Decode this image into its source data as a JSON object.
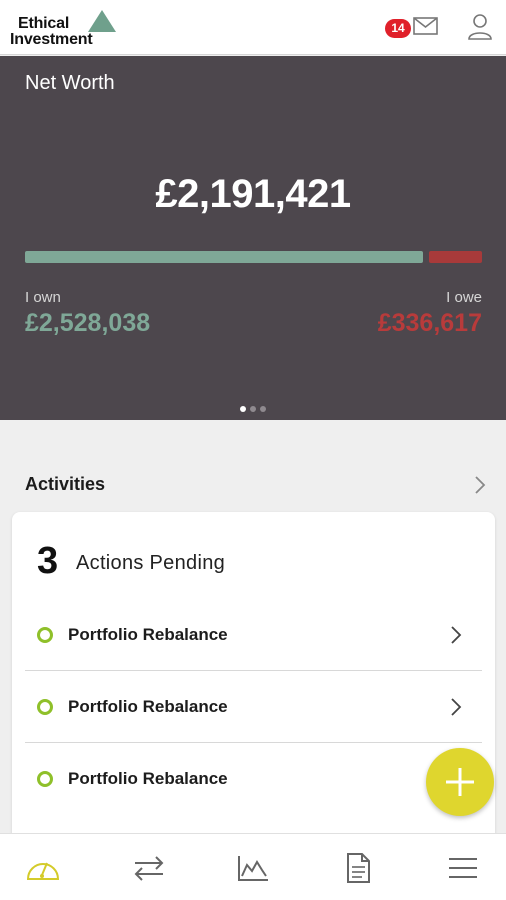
{
  "header": {
    "logo_line1": "Ethical",
    "logo_line2": "Investment",
    "notification_count": "14",
    "icons": [
      "mail-icon",
      "user-icon"
    ]
  },
  "networth": {
    "title": "Net Worth",
    "amount": "£2,191,421",
    "own_label": "I own",
    "own_value": "£2,528,038",
    "owe_label": "I owe",
    "owe_value": "£336,617",
    "own_fraction": 0.882,
    "carousel_pages": 3,
    "carousel_active": 0,
    "colors": {
      "background": "#4d474d",
      "own": "#7fa897",
      "owe": "#b83b3b"
    }
  },
  "activities": {
    "title": "Activities",
    "pending_count": "3",
    "pending_label": "Actions Pending",
    "items": [
      {
        "label": "Portfolio Rebalance"
      },
      {
        "label": "Portfolio Rebalance"
      },
      {
        "label": "Portfolio Rebalance"
      }
    ]
  },
  "fab": {
    "icon": "plus-icon",
    "color": "#dfd62e"
  },
  "bottom_nav": {
    "items": [
      {
        "icon": "dashboard-gauge-icon",
        "active": true
      },
      {
        "icon": "transfer-arrows-icon",
        "active": false
      },
      {
        "icon": "chart-icon",
        "active": false
      },
      {
        "icon": "document-icon",
        "active": false
      },
      {
        "icon": "menu-icon",
        "active": false
      }
    ],
    "active_color": "#d4cb2a"
  }
}
